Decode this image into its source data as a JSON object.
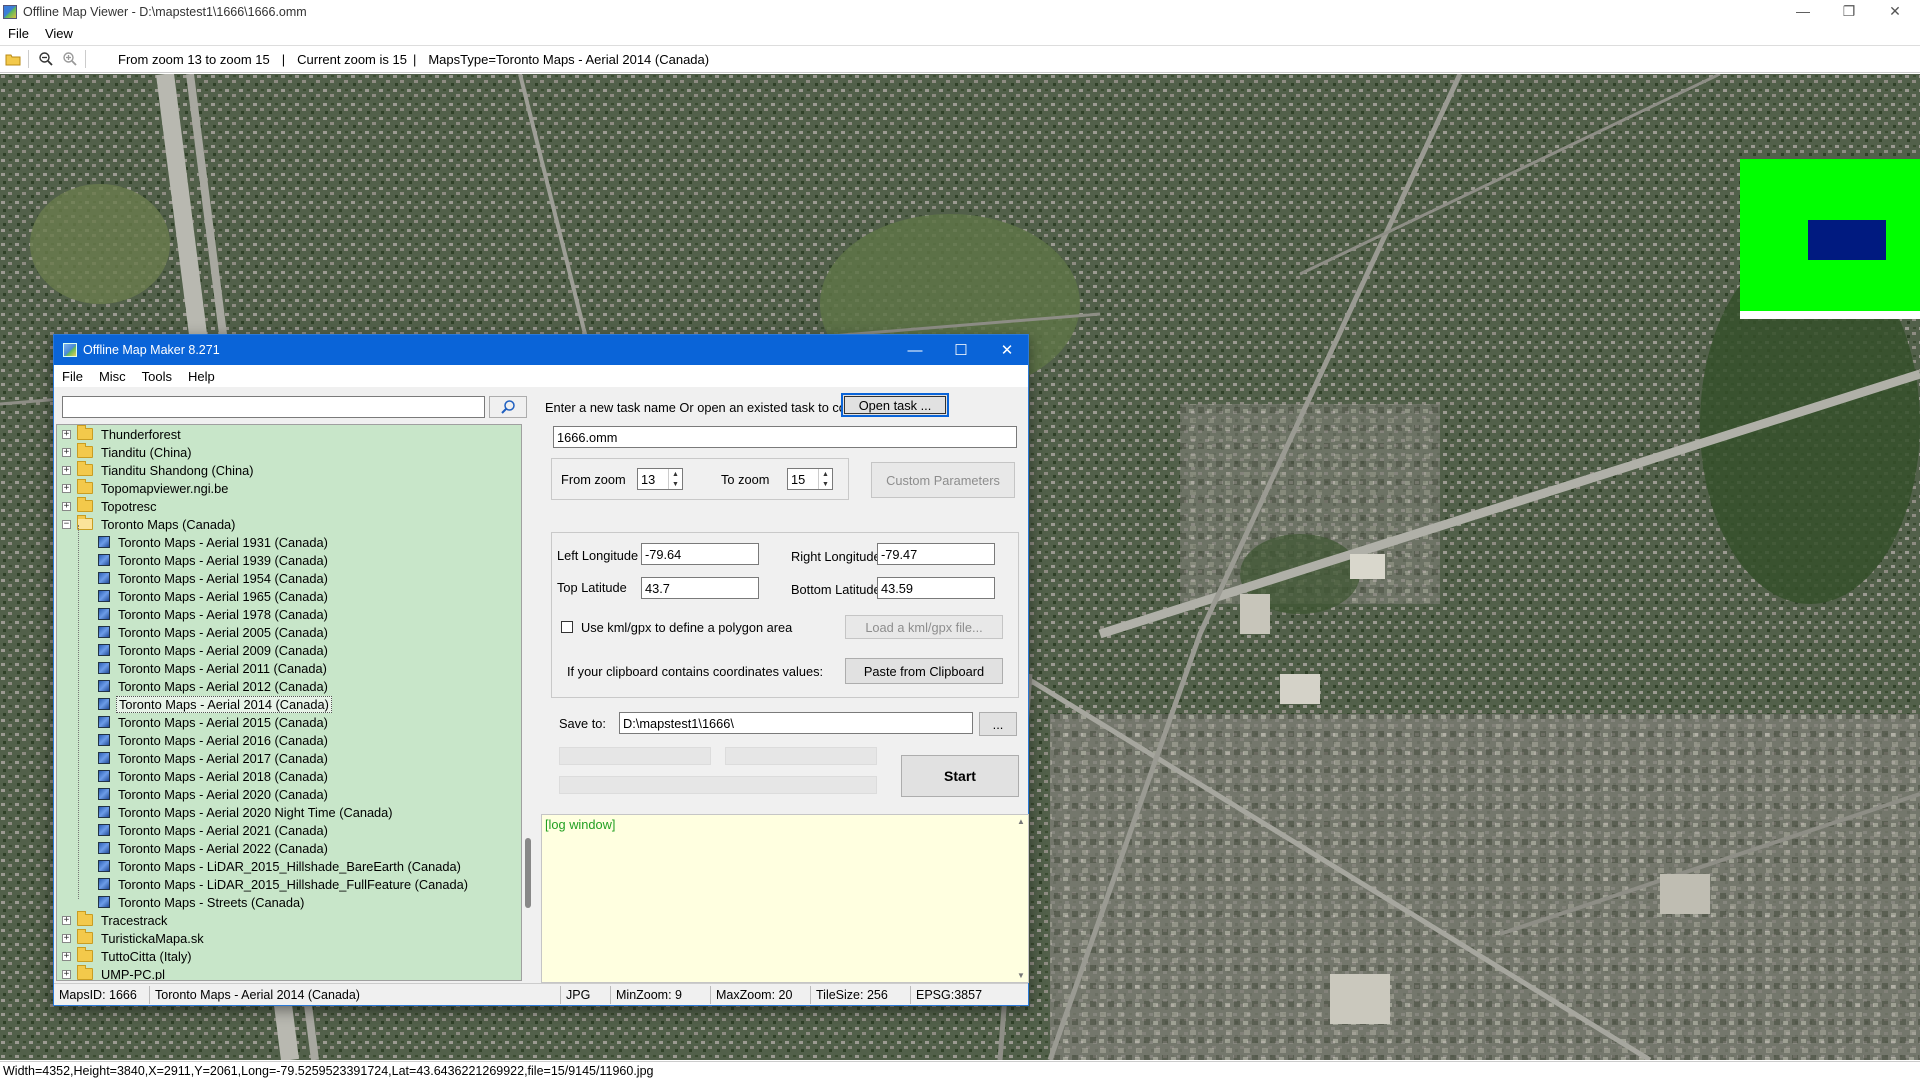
{
  "window": {
    "title": "Offline Map Viewer - D:\\mapstest1\\1666\\1666.omm",
    "menu": [
      "File",
      "View"
    ]
  },
  "toolbar": {
    "zoom_range": "From zoom 13 to zoom 15",
    "current_zoom": "Current zoom is 15",
    "maps_type": "MapsType=Toronto Maps - Aerial 2014 (Canada)",
    "separator": "|"
  },
  "status": "Width=4352,Height=3840,X=2911,Y=2061,Long=-79.5259523391724,Lat=43.6436221269922,file=15/9145/11960.jpg",
  "dialog": {
    "title": "Offline Map Maker 8.271",
    "menu": [
      "File",
      "Misc",
      "Tools",
      "Help"
    ],
    "search_value": "",
    "tree": [
      {
        "label": "Thunderforest",
        "type": "folder",
        "level": 0,
        "expander": "+"
      },
      {
        "label": "Tianditu (China)",
        "type": "folder",
        "level": 0,
        "expander": "+"
      },
      {
        "label": "Tianditu Shandong (China)",
        "type": "folder",
        "level": 0,
        "expander": "+"
      },
      {
        "label": "Topomapviewer.ngi.be",
        "type": "folder",
        "level": 0,
        "expander": "+"
      },
      {
        "label": "Topotresc",
        "type": "folder",
        "level": 0,
        "expander": "+"
      },
      {
        "label": "Toronto Maps (Canada)",
        "type": "folder-open",
        "level": 0,
        "expander": "−"
      },
      {
        "label": "Toronto Maps - Aerial 1931 (Canada)",
        "type": "map",
        "level": 1
      },
      {
        "label": "Toronto Maps - Aerial 1939 (Canada)",
        "type": "map",
        "level": 1
      },
      {
        "label": "Toronto Maps - Aerial 1954 (Canada)",
        "type": "map",
        "level": 1
      },
      {
        "label": "Toronto Maps - Aerial 1965 (Canada)",
        "type": "map",
        "level": 1
      },
      {
        "label": "Toronto Maps - Aerial 1978 (Canada)",
        "type": "map",
        "level": 1
      },
      {
        "label": "Toronto Maps - Aerial 2005 (Canada)",
        "type": "map",
        "level": 1
      },
      {
        "label": "Toronto Maps - Aerial 2009 (Canada)",
        "type": "map",
        "level": 1
      },
      {
        "label": "Toronto Maps - Aerial 2011 (Canada)",
        "type": "map",
        "level": 1
      },
      {
        "label": "Toronto Maps - Aerial 2012 (Canada)",
        "type": "map",
        "level": 1
      },
      {
        "label": "Toronto Maps - Aerial 2014 (Canada)",
        "type": "map",
        "level": 1,
        "selected": true
      },
      {
        "label": "Toronto Maps - Aerial 2015 (Canada)",
        "type": "map",
        "level": 1
      },
      {
        "label": "Toronto Maps - Aerial 2016 (Canada)",
        "type": "map",
        "level": 1
      },
      {
        "label": "Toronto Maps - Aerial 2017 (Canada)",
        "type": "map",
        "level": 1
      },
      {
        "label": "Toronto Maps - Aerial 2018 (Canada)",
        "type": "map",
        "level": 1
      },
      {
        "label": "Toronto Maps - Aerial 2020 (Canada)",
        "type": "map",
        "level": 1
      },
      {
        "label": "Toronto Maps - Aerial 2020 Night Time (Canada)",
        "type": "map",
        "level": 1
      },
      {
        "label": "Toronto Maps - Aerial 2021 (Canada)",
        "type": "map",
        "level": 1
      },
      {
        "label": "Toronto Maps - Aerial 2022 (Canada)",
        "type": "map",
        "level": 1
      },
      {
        "label": "Toronto Maps - LiDAR_2015_Hillshade_BareEarth (Canada)",
        "type": "map",
        "level": 1
      },
      {
        "label": "Toronto Maps - LiDAR_2015_Hillshade_FullFeature (Canada)",
        "type": "map",
        "level": 1
      },
      {
        "label": "Toronto Maps - Streets (Canada)",
        "type": "map",
        "level": 1
      },
      {
        "label": "Tracestrack",
        "type": "folder",
        "level": 0,
        "expander": "+"
      },
      {
        "label": "TuristickaMapa.sk",
        "type": "folder",
        "level": 0,
        "expander": "+"
      },
      {
        "label": "TuttoCitta (Italy)",
        "type": "folder",
        "level": 0,
        "expander": "+"
      },
      {
        "label": "UMP-PC.pl",
        "type": "folder",
        "level": 0,
        "expander": "+"
      }
    ],
    "task_prompt": "Enter a new task name Or open an existed task to continue:",
    "open_task": "Open task ...",
    "task_name": "1666.omm",
    "from_zoom_label": "From zoom",
    "from_zoom": "13",
    "to_zoom_label": "To zoom",
    "to_zoom": "15",
    "custom_params": "Custom Parameters",
    "left_lon_label": "Left Longitude",
    "left_lon": "-79.64",
    "right_lon_label": "Right Longitude",
    "right_lon": "-79.47",
    "top_lat_label": "Top Latitude",
    "top_lat": "43.7",
    "bottom_lat_label": "Bottom Latitude",
    "bottom_lat": "43.59",
    "kml_label": "Use kml/gpx to define a polygon area",
    "load_kml": "Load a kml/gpx file...",
    "clipboard_label": "If your clipboard contains coordinates values:",
    "paste_clipboard": "Paste from Clipboard",
    "save_to_label": "Save to:",
    "save_to": "D:\\mapstest1\\1666\\",
    "browse": "...",
    "start": "Start",
    "log": "[log window]",
    "status": {
      "maps_id": "MapsID: 1666",
      "maps_name": "Toronto Maps - Aerial 2014 (Canada)",
      "format": "JPG",
      "min_zoom": "MinZoom: 9",
      "max_zoom": "MaxZoom: 20",
      "tile_size": "TileSize: 256",
      "epsg": "EPSG:3857"
    }
  },
  "colors": {
    "dialog_title_bg": "#0a64d8",
    "tree_bg": "#c8e6c9",
    "overview_bg": "#00ff00",
    "overview_viewport": "#001a80",
    "log_bg": "#ffffe0",
    "log_text": "#22a022"
  }
}
